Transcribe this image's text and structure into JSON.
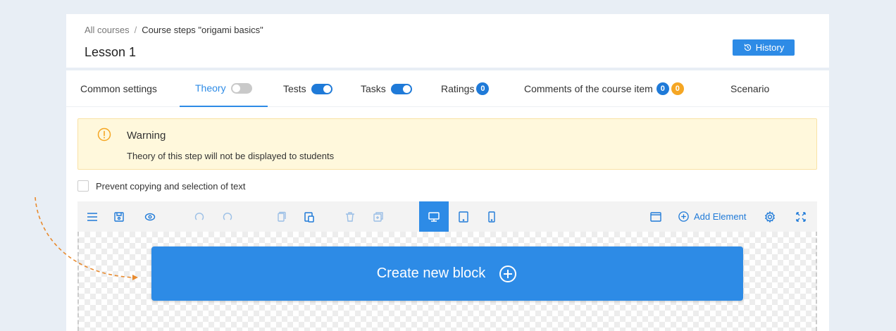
{
  "breadcrumb": {
    "root": "All courses",
    "separator": "/",
    "current": "Course steps \"origami basics\""
  },
  "page": {
    "title": "Lesson 1"
  },
  "history_button": {
    "label": "History"
  },
  "tabs": [
    {
      "label": "Common settings"
    },
    {
      "label": "Theory",
      "toggle": "off",
      "active": true
    },
    {
      "label": "Tests",
      "toggle": "on"
    },
    {
      "label": "Tasks",
      "toggle": "on"
    },
    {
      "label": "Ratings",
      "badges": [
        "0"
      ]
    },
    {
      "label": "Comments of the course item",
      "badges": [
        "0",
        "0"
      ]
    },
    {
      "label": "Scenario"
    }
  ],
  "warning": {
    "title": "Warning",
    "text": "Theory of this step will not be displayed to students"
  },
  "copy_protection": {
    "label": "Prevent copying and selection of text",
    "checked": false
  },
  "toolbar": {
    "add_element_label": "Add Element",
    "tools": [
      "menu-icon",
      "save-icon",
      "preview-eye-icon",
      "undo-icon",
      "redo-icon",
      "copy-icon",
      "paste-icon",
      "delete-icon",
      "duplicate-icon",
      "desktop-icon",
      "tablet-icon",
      "mobile-icon",
      "window-icon",
      "add-icon",
      "settings-gear-icon",
      "fullscreen-icon"
    ],
    "selected_device": "desktop"
  },
  "create_block": {
    "label": "Create new block"
  },
  "colors": {
    "accent": "#2d8be6",
    "toggle_on": "#1f7ad8",
    "badge_orange": "#f5a623",
    "warning_bg": "#fff8dc",
    "arrow": "#e88a2e"
  }
}
